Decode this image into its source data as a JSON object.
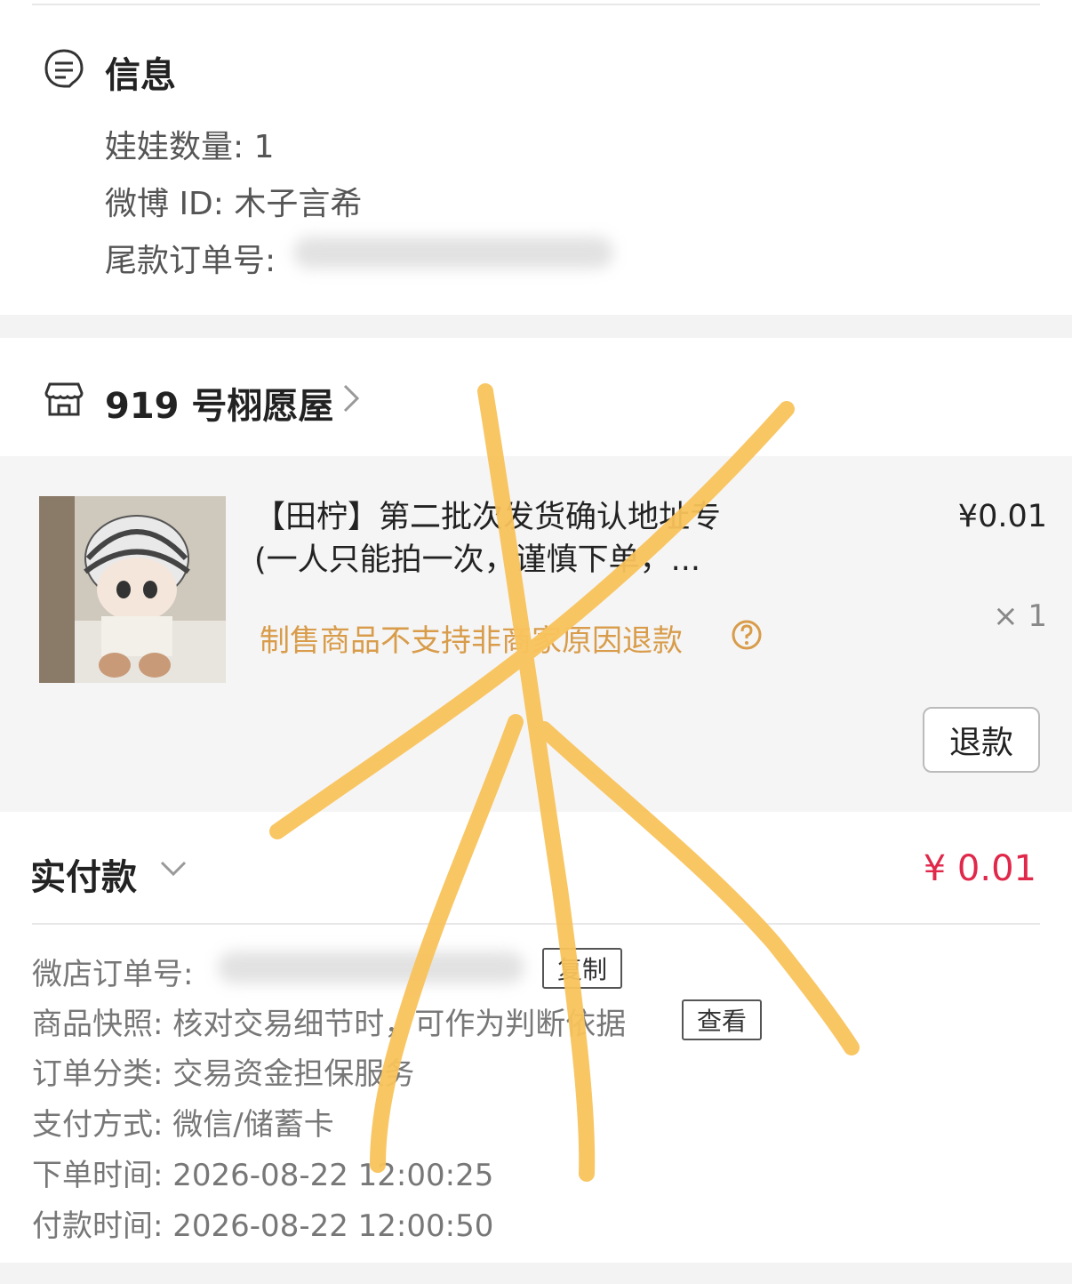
{
  "info": {
    "title": "信息",
    "doll_count": "娃娃数量: 1",
    "weibo_id": "微博 ID: 木子言希",
    "final_order_label": "尾款订单号:"
  },
  "shop": {
    "name": "919 号栩愿屋",
    "product": {
      "title_line1": "【田柠】第二批次发货确认地址专",
      "title_line2": "(一人只能拍一次，谨慎下单，...",
      "price": "¥0.01",
      "quantity": "× 1",
      "warning": "制售商品不支持非商家原因退款",
      "refund_label": "退款"
    }
  },
  "payment": {
    "label": "实付款",
    "amount": "¥ 0.01"
  },
  "details": {
    "order_no_label": "微店订单号:",
    "copy_label": "复制",
    "snapshot_text": "商品快照: 核对交易细节时，可作为判断依据",
    "view_label": "查看",
    "category": "订单分类:  交易资金担保服务",
    "pay_method": "支付方式:  微信/储蓄卡",
    "order_time": "下单时间:  2026-08-22 12:00:25",
    "pay_time": "付款时间:  2026-08-22 12:00:50"
  },
  "colors": {
    "accent_red": "#e0284a",
    "warning_orange": "#d89c4a",
    "scribble": "#f9c35c"
  }
}
